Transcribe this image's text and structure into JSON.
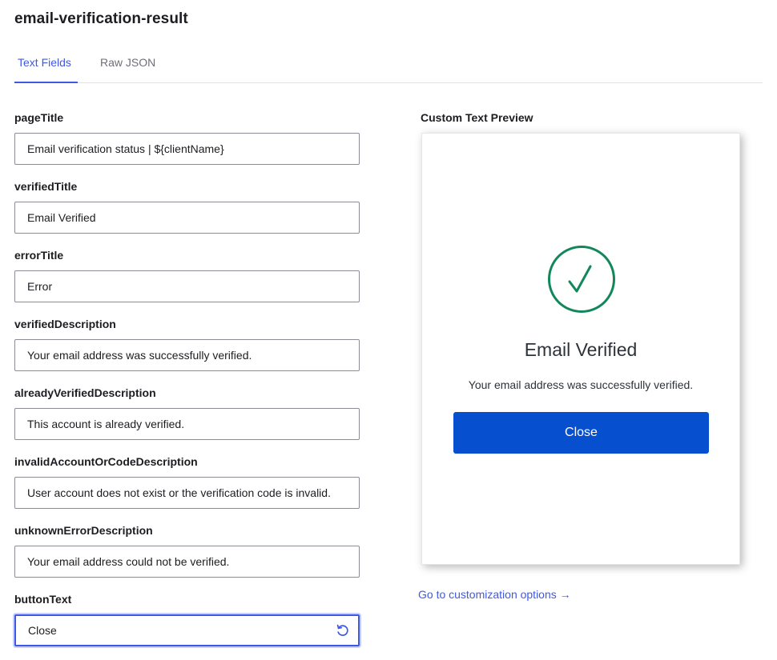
{
  "header": {
    "title": "email-verification-result"
  },
  "tabs": [
    {
      "label": "Text Fields",
      "active": true
    },
    {
      "label": "Raw JSON",
      "active": false
    }
  ],
  "fields": [
    {
      "label": "pageTitle",
      "value": "Email verification status | ${clientName}"
    },
    {
      "label": "verifiedTitle",
      "value": "Email Verified"
    },
    {
      "label": "errorTitle",
      "value": "Error"
    },
    {
      "label": "verifiedDescription",
      "value": "Your email address was successfully verified."
    },
    {
      "label": "alreadyVerifiedDescription",
      "value": "This account is already verified."
    },
    {
      "label": "invalidAccountOrCodeDescription",
      "value": "User account does not exist or the verification code is invalid."
    },
    {
      "label": "unknownErrorDescription",
      "value": "Your email address could not be verified."
    },
    {
      "label": "buttonText",
      "value": "Close",
      "focused": true
    }
  ],
  "preview": {
    "label": "Custom Text Preview",
    "icon": "check-circle-icon",
    "title": "Email Verified",
    "description": "Your email address was successfully verified.",
    "button_label": "Close"
  },
  "link": {
    "label": "Go to customization options →"
  },
  "colors": {
    "accent": "#3f59e4",
    "preview_button": "#0650d0",
    "success": "#13875c"
  }
}
